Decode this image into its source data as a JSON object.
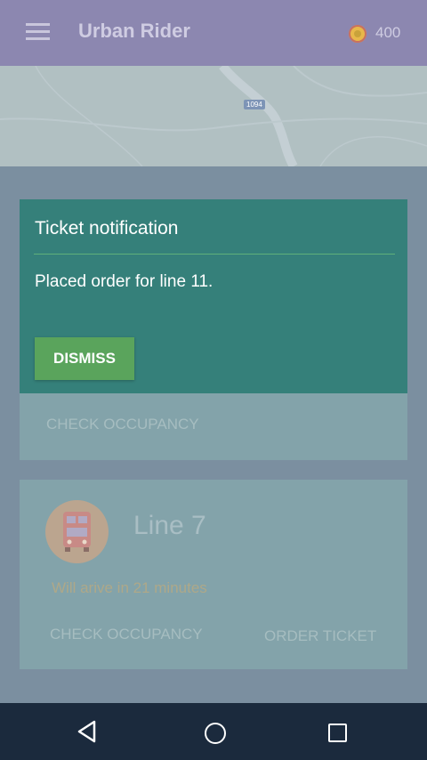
{
  "appbar": {
    "title": "Urban Rider",
    "coins": "400",
    "coin_icon": "coin-icon",
    "menu_icon": "menu-icon"
  },
  "map": {
    "road_label": "1094"
  },
  "card1": {
    "check_occupancy": "CHECK OCCUPANCY"
  },
  "card2": {
    "line": "Line 7",
    "arrival": "Will arive in 21 minutes",
    "check_occupancy": "CHECK OCCUPANCY",
    "order_ticket": "ORDER TICKET",
    "icon": "bus-icon"
  },
  "dialog": {
    "title": "Ticket notification",
    "message": "Placed order for line 11.",
    "dismiss_label": "DISMISS"
  },
  "navbar": {
    "back_icon": "back-icon",
    "home_icon": "home-icon",
    "recents_icon": "recents-icon"
  },
  "colors": {
    "appbar": "#8c87b0",
    "dialog": "#35807a",
    "dismiss": "#5aa45c",
    "navbar": "#1b2a3d"
  }
}
